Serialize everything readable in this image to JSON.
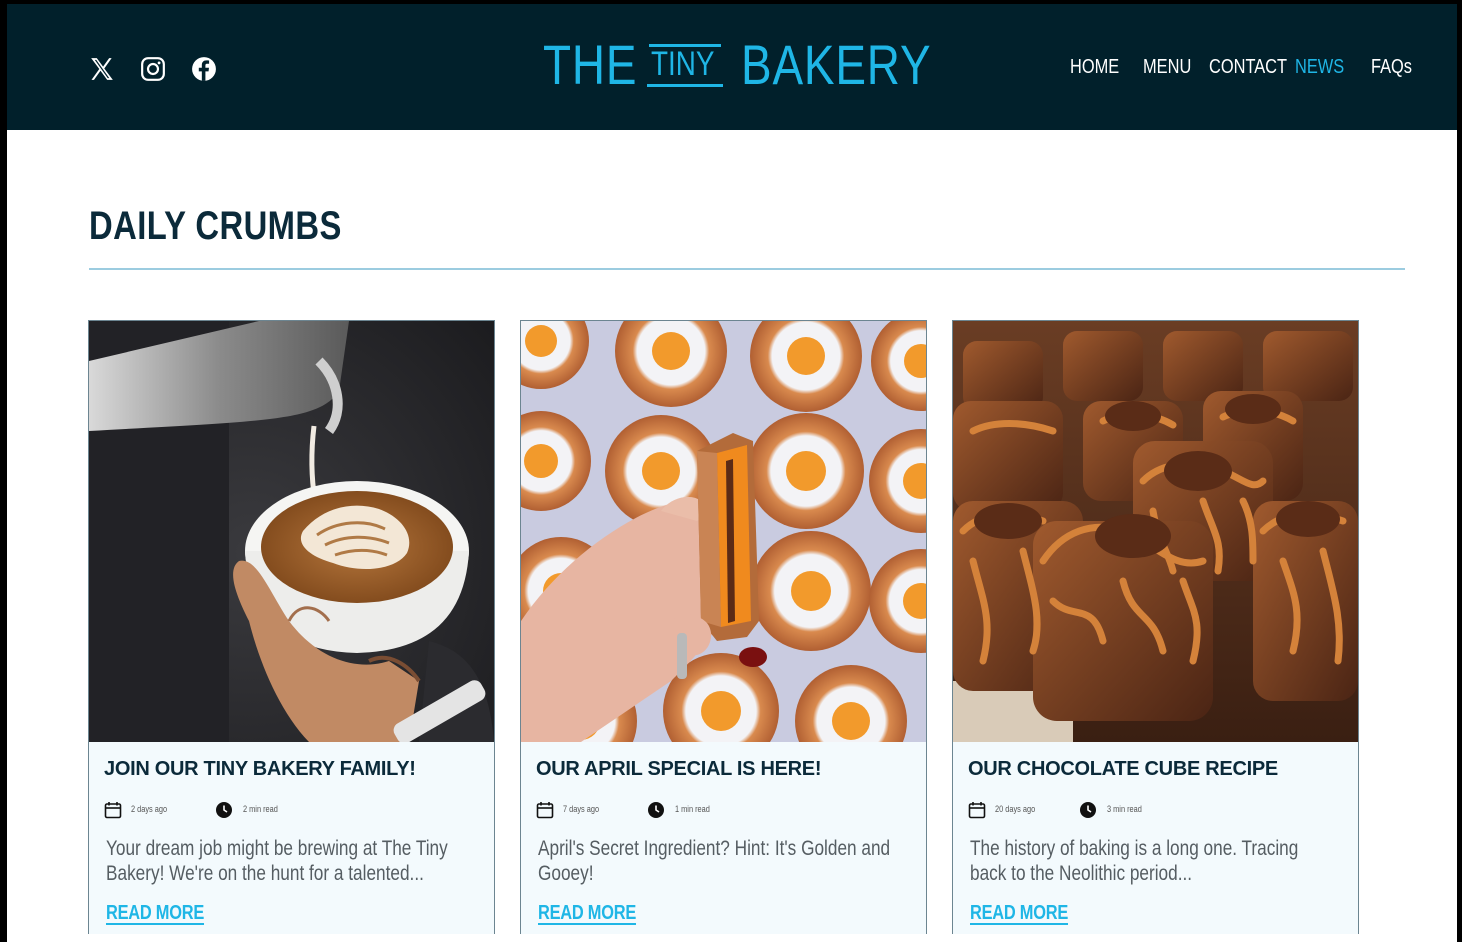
{
  "header": {
    "social": [
      {
        "icon": "x-twitter-icon"
      },
      {
        "icon": "instagram-icon"
      },
      {
        "icon": "facebook-icon"
      }
    ],
    "logo": {
      "the": "THE",
      "tiny": "TINY",
      "bakery": "BAKERY"
    },
    "nav": [
      {
        "label": "HOME",
        "active": false
      },
      {
        "label": "MENU",
        "active": false
      },
      {
        "label": "CONTACT",
        "active": false
      },
      {
        "label": "NEWS",
        "active": true
      },
      {
        "label": "FAQs",
        "active": false
      }
    ]
  },
  "main": {
    "title": "DAILY CRUMBS",
    "cards": [
      {
        "title": "JOIN OUR TINY BAKERY FAMILY!",
        "date": "2 days ago",
        "read_time": "2 min read",
        "excerpt_line1": "Your dream job might be brewing at The Tiny",
        "excerpt_line2": "Bakery! We're on the hunt for a talented...",
        "cta": "READ MORE",
        "image": "latte-art-pour-photo"
      },
      {
        "title": "OUR APRIL SPECIAL IS HERE!",
        "date": "7 days ago",
        "read_time": "1 min read",
        "excerpt_line1": "April's Secret Ingredient? Hint: It's Golden and",
        "excerpt_line2": "Gooey!",
        "cta": "READ MORE",
        "image": "egg-pastries-photo"
      },
      {
        "title": "OUR CHOCOLATE CUBE RECIPE",
        "date": "20 days ago",
        "read_time": "3 min read",
        "excerpt_line1": "The history of baking is a long one. Tracing",
        "excerpt_line2": "back to the Neolithic period...",
        "cta": "READ MORE",
        "image": "chocolate-cube-pastries-photo"
      }
    ]
  },
  "colors": {
    "header_bg": "#01202b",
    "accent": "#1fb6e6",
    "title": "#0b2a3a",
    "card_bg": "#f3fafd"
  }
}
